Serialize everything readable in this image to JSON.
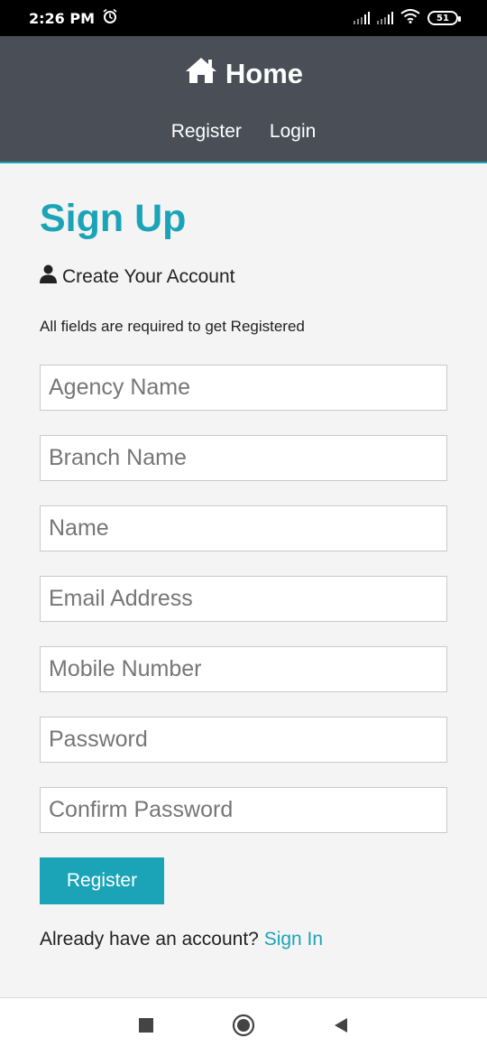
{
  "status_bar": {
    "time": "2:26 PM",
    "battery": "51",
    "icons": [
      "alarm-icon",
      "signal-icon",
      "signal-icon",
      "wifi-icon",
      "battery-icon"
    ]
  },
  "navbar": {
    "brand_icon": "home-icon",
    "brand": "Home",
    "links": [
      {
        "label": "Register"
      },
      {
        "label": "Login"
      }
    ],
    "accent": "#19a3b8",
    "background": "#4a4e57"
  },
  "page": {
    "title": "Sign Up",
    "subtitle_icon": "user-icon",
    "subtitle": "Create Your Account",
    "hint": "All fields are required to get Registered"
  },
  "form": {
    "fields": [
      {
        "placeholder": "Agency Name",
        "value": ""
      },
      {
        "placeholder": "Branch Name",
        "value": ""
      },
      {
        "placeholder": "Name",
        "value": ""
      },
      {
        "placeholder": "Email Address",
        "value": ""
      },
      {
        "placeholder": "Mobile Number",
        "value": ""
      },
      {
        "placeholder": "Password",
        "value": ""
      },
      {
        "placeholder": "Confirm Password",
        "value": ""
      }
    ],
    "submit_label": "Register",
    "signin_prompt": "Already have an account?",
    "signin_link": "Sign In",
    "accent": "#1ba4b7"
  },
  "bottom_nav": {
    "icons": [
      "square-icon",
      "home-circle-icon",
      "back-triangle-icon"
    ]
  }
}
